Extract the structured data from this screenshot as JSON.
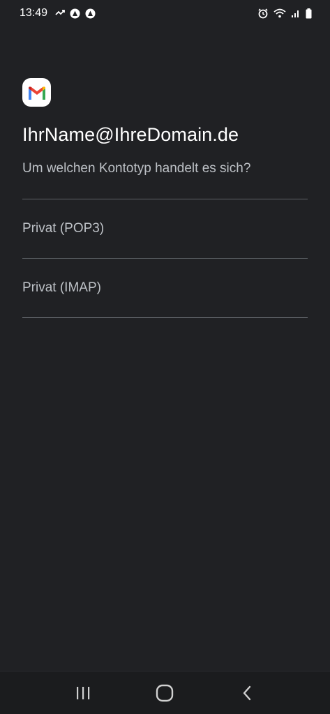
{
  "status_bar": {
    "time": "13:49",
    "left_icons": [
      "missed-call-icon",
      "app-notification-icon",
      "app-notification-icon"
    ],
    "right_icons": [
      "alarm-icon",
      "wifi-icon",
      "signal-icon",
      "battery-icon"
    ]
  },
  "app": {
    "logo": "gmail-logo-icon",
    "account_email": "IhrName@IhreDomain.de",
    "question": "Um welchen Kontotyp handelt es sich?",
    "options": [
      {
        "label": "Privat (POP3)"
      },
      {
        "label": "Privat (IMAP)"
      }
    ]
  },
  "nav_bar": {
    "buttons": [
      "recent-apps-icon",
      "home-icon",
      "back-icon"
    ]
  },
  "colors": {
    "background": "#202124",
    "primary_text": "#ffffff",
    "secondary_text": "#bdc1c6",
    "divider": "#5f6368",
    "gmail_red": "#EA4335",
    "gmail_blue": "#4285F4",
    "gmail_green": "#34A853",
    "gmail_yellow": "#FBBC04"
  }
}
